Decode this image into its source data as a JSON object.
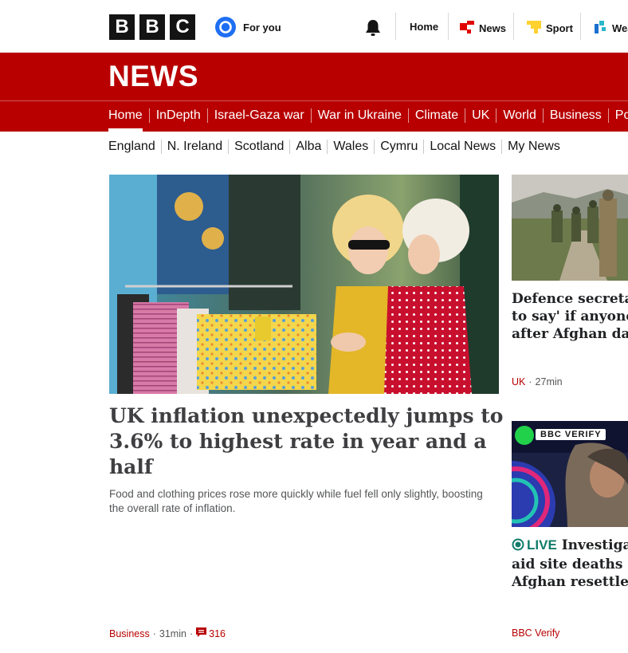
{
  "header": {
    "logo_letters": [
      "B",
      "B",
      "C"
    ],
    "for_you_label": "For you",
    "links": [
      {
        "label": "Home",
        "icon": "none"
      },
      {
        "label": "News",
        "icon": "news-icon"
      },
      {
        "label": "Sport",
        "icon": "sport-icon"
      },
      {
        "label": "Weather",
        "icon": "weather-icon"
      }
    ]
  },
  "section": {
    "title": "NEWS",
    "nav": [
      "Home",
      "InDepth",
      "Israel-Gaza war",
      "War in Ukraine",
      "Climate",
      "UK",
      "World",
      "Business",
      "Politics"
    ],
    "active": "Home",
    "subnav": [
      "England",
      "N. Ireland",
      "Scotland",
      "Alba",
      "Wales",
      "Cymru",
      "Local News",
      "My News"
    ]
  },
  "colors": {
    "brand_red": "#b80000",
    "live_green": "#117c6b"
  },
  "main_story": {
    "headline": "UK inflation unexpectedly jumps to 3.6% to highest rate in year and a half",
    "summary": "Food and clothing prices rose more quickly while fuel fell only slightly, boosting the overall rate of inflation.",
    "category": "Business",
    "age": "31min",
    "comments": "316"
  },
  "side_stories": [
    {
      "lines": [
        "Defence secretary",
        "to say' if anyone",
        "after Afghan data"
      ],
      "category": "UK",
      "age": "27min"
    },
    {
      "badge": "BBC VERIFY",
      "live_label": "LIVE",
      "lines": [
        "Investigates",
        "aid site deaths and",
        "Afghan resettlement"
      ],
      "category": "BBC Verify"
    }
  ]
}
